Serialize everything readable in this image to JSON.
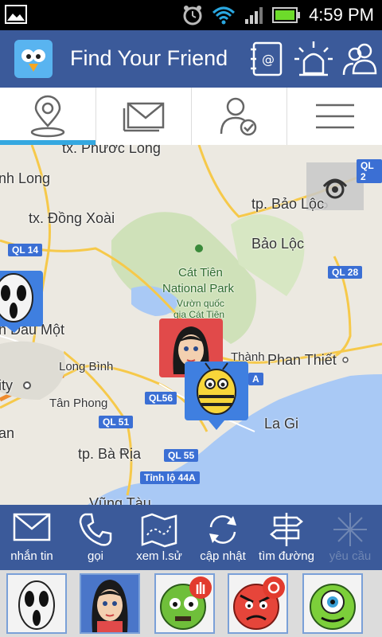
{
  "status_bar": {
    "time": "4:59 PM"
  },
  "app_bar": {
    "title": "Find Your Friend"
  },
  "tabs": [
    {
      "name": "map",
      "icon": "location-pin-icon",
      "active": true
    },
    {
      "name": "messages",
      "icon": "envelope-icon",
      "active": false
    },
    {
      "name": "contacts",
      "icon": "user-check-icon",
      "active": false
    },
    {
      "name": "menu",
      "icon": "hamburger-menu-icon",
      "active": false
    }
  ],
  "map": {
    "places": {
      "phuoc_long": "tx. Phước Long",
      "binh_long": "nh Long",
      "dong_xoai": "tx. Đồng Xoài",
      "tp_bao_loc": "tp. Bảo Lộc",
      "bao_loc": "Bảo Lộc",
      "cat_tien_1": "Cát Tiên",
      "cat_tien_2": "National Park",
      "cat_tien_3": "Vườn quốc",
      "cat_tien_4": "gia Cát Tiên",
      "dau_mot": "h Dầu Một",
      "long_binh": "Long Bình",
      "city": "ity",
      "tan_phong": "Tân Phong",
      "phan_thiet": "Phan Thiết",
      "thanh": "Thành",
      "la_gi": "La Gi",
      "ba_ria": "tp. Bà Rịa",
      "vung_tau": "Vũng Tàu",
      "an": "an"
    },
    "roads": {
      "ql14": "QL 14",
      "ql20": "QL 2",
      "ql28": "QL 28",
      "ql1a": "A",
      "ql56": "QL56",
      "ql51": "QL 51",
      "ql55": "QL 55",
      "tl44a": "Tỉnh lộ 44A"
    }
  },
  "actions": {
    "message": "nhắn tin",
    "call": "gọi",
    "history": "xem l.sử",
    "update": "cập nhật",
    "directions": "tìm đường",
    "request": "yêu cầu"
  },
  "friends": [
    {
      "avatar": "ghost-mask-avatar",
      "selected": false
    },
    {
      "avatar": "girl-avatar",
      "selected": true
    },
    {
      "avatar": "zombie-avatar",
      "selected": false,
      "badge": "hand-stop-icon"
    },
    {
      "avatar": "angry-face-avatar",
      "selected": false,
      "badge": "alarm-icon"
    },
    {
      "avatar": "one-eyed-monster-avatar",
      "selected": false
    }
  ],
  "colors": {
    "app_bar": "#3b5a9a",
    "tab_indicator": "#35a8e0",
    "road_badge": "#3b6fd4",
    "sea": "#a9c9f5"
  }
}
